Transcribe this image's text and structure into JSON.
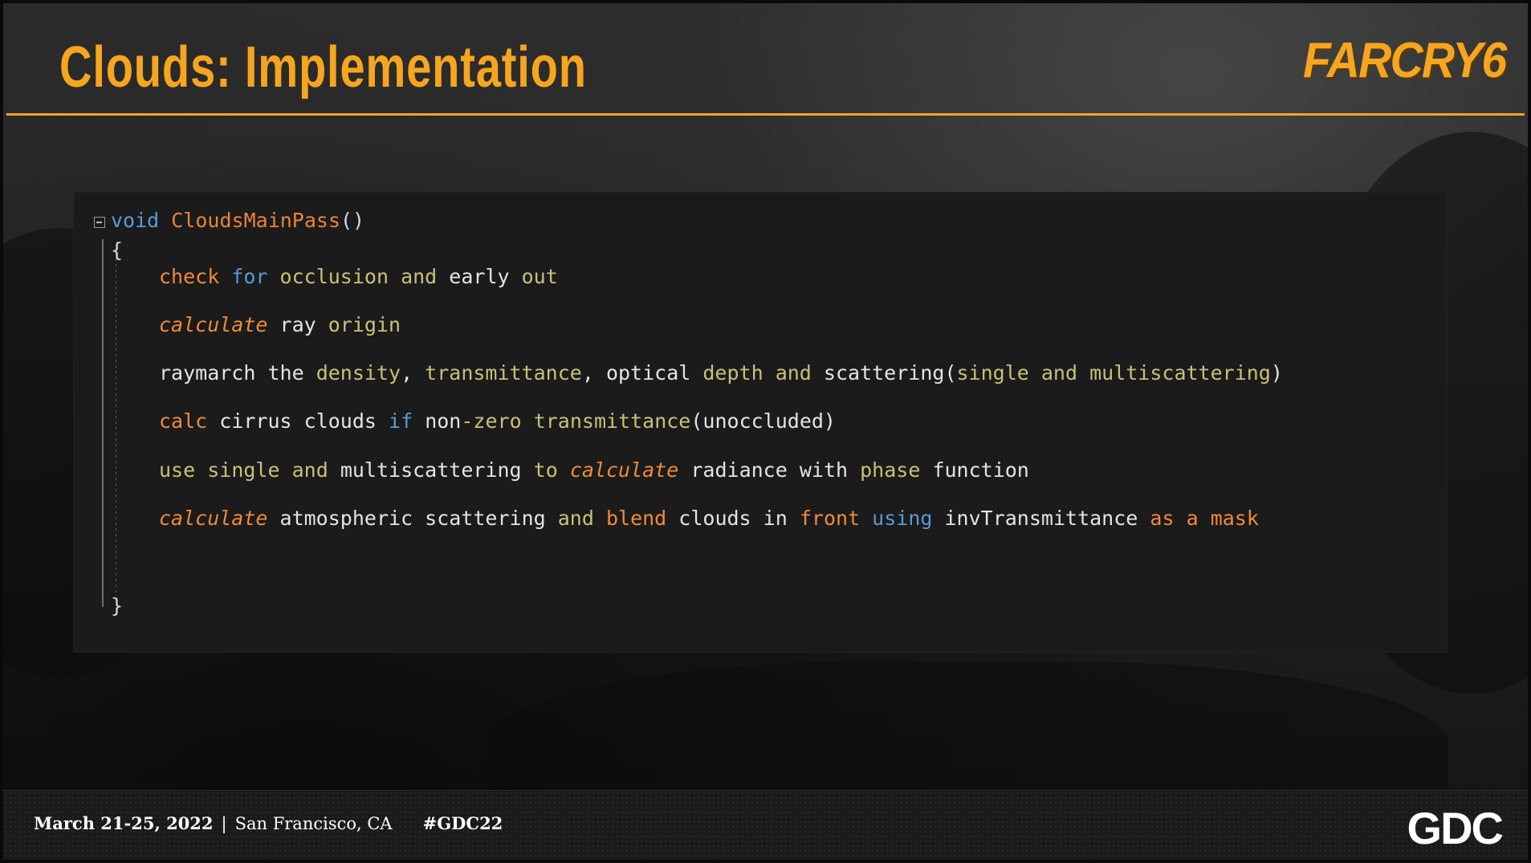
{
  "header": {
    "title": "Clouds: Implementation",
    "logo_text": "FARCRY6",
    "accent_color": "#f6a51f"
  },
  "code": {
    "signature": {
      "keyword": "void",
      "name": "CloudsMainPass",
      "parens": "()"
    },
    "open_brace": "{",
    "close_brace": "}",
    "lines": [
      [
        {
          "t": "check",
          "c": "or"
        },
        {
          "t": " "
        },
        {
          "t": "for",
          "c": "bl"
        },
        {
          "t": " "
        },
        {
          "t": "occlusion",
          "c": "ye"
        },
        {
          "t": " "
        },
        {
          "t": "and",
          "c": "ye"
        },
        {
          "t": " "
        },
        {
          "t": "early",
          "c": "wh"
        },
        {
          "t": " "
        },
        {
          "t": "out",
          "c": "ye"
        }
      ],
      [
        {
          "t": "calculate",
          "c": "it"
        },
        {
          "t": " "
        },
        {
          "t": "ray",
          "c": "wh"
        },
        {
          "t": " "
        },
        {
          "t": "origin",
          "c": "ye"
        }
      ],
      [
        {
          "t": "raymarch",
          "c": "wh"
        },
        {
          "t": " "
        },
        {
          "t": "the",
          "c": "wh"
        },
        {
          "t": " "
        },
        {
          "t": "density",
          "c": "ye"
        },
        {
          "t": ", ",
          "c": "wh"
        },
        {
          "t": "transmittance",
          "c": "ye"
        },
        {
          "t": ", ",
          "c": "wh"
        },
        {
          "t": "optical",
          "c": "wh"
        },
        {
          "t": " "
        },
        {
          "t": "depth",
          "c": "ye"
        },
        {
          "t": " "
        },
        {
          "t": "and",
          "c": "ye"
        },
        {
          "t": " "
        },
        {
          "t": "scattering",
          "c": "wh"
        },
        {
          "t": "(",
          "c": "wh"
        },
        {
          "t": "single",
          "c": "ye"
        },
        {
          "t": " "
        },
        {
          "t": "and",
          "c": "ye"
        },
        {
          "t": " "
        },
        {
          "t": "multiscattering",
          "c": "ye"
        },
        {
          "t": ")",
          "c": "wh"
        }
      ],
      [
        {
          "t": "calc",
          "c": "or"
        },
        {
          "t": " "
        },
        {
          "t": "cirrus",
          "c": "wh"
        },
        {
          "t": " "
        },
        {
          "t": "clouds",
          "c": "wh"
        },
        {
          "t": " "
        },
        {
          "t": "if",
          "c": "bl"
        },
        {
          "t": " "
        },
        {
          "t": "non",
          "c": "wh"
        },
        {
          "t": "-zero",
          "c": "ye"
        },
        {
          "t": " "
        },
        {
          "t": "transmittance",
          "c": "ye"
        },
        {
          "t": "(unoccluded)",
          "c": "wh"
        }
      ],
      [
        {
          "t": "use",
          "c": "ye"
        },
        {
          "t": " "
        },
        {
          "t": "single",
          "c": "ye"
        },
        {
          "t": " "
        },
        {
          "t": "and",
          "c": "ye"
        },
        {
          "t": " "
        },
        {
          "t": "multiscattering",
          "c": "wh"
        },
        {
          "t": " "
        },
        {
          "t": "to",
          "c": "ye"
        },
        {
          "t": " "
        },
        {
          "t": "calculate",
          "c": "it"
        },
        {
          "t": " "
        },
        {
          "t": "radiance",
          "c": "wh"
        },
        {
          "t": " "
        },
        {
          "t": "with",
          "c": "wh"
        },
        {
          "t": " "
        },
        {
          "t": "phase",
          "c": "ye"
        },
        {
          "t": " "
        },
        {
          "t": "function",
          "c": "wh"
        }
      ],
      [
        {
          "t": "calculate",
          "c": "it"
        },
        {
          "t": " "
        },
        {
          "t": "atmospheric",
          "c": "wh"
        },
        {
          "t": " "
        },
        {
          "t": "scattering",
          "c": "wh"
        },
        {
          "t": " "
        },
        {
          "t": "and",
          "c": "ye"
        },
        {
          "t": " "
        },
        {
          "t": "blend",
          "c": "or"
        },
        {
          "t": " "
        },
        {
          "t": "clouds",
          "c": "wh"
        },
        {
          "t": " "
        },
        {
          "t": "in",
          "c": "wh"
        },
        {
          "t": " "
        },
        {
          "t": "front",
          "c": "or"
        },
        {
          "t": " "
        },
        {
          "t": "using",
          "c": "bl"
        },
        {
          "t": " "
        },
        {
          "t": "invTransmittance",
          "c": "wh"
        },
        {
          "t": " "
        },
        {
          "t": "as",
          "c": "or"
        },
        {
          "t": " "
        },
        {
          "t": "a",
          "c": "or"
        },
        {
          "t": " "
        },
        {
          "t": "mask",
          "c": "or"
        }
      ]
    ]
  },
  "footer": {
    "date": "March 21-25, 2022",
    "separator": "|",
    "location": "San Francisco, CA",
    "hashtag": "#GDC22",
    "logo_text": "GDC"
  }
}
